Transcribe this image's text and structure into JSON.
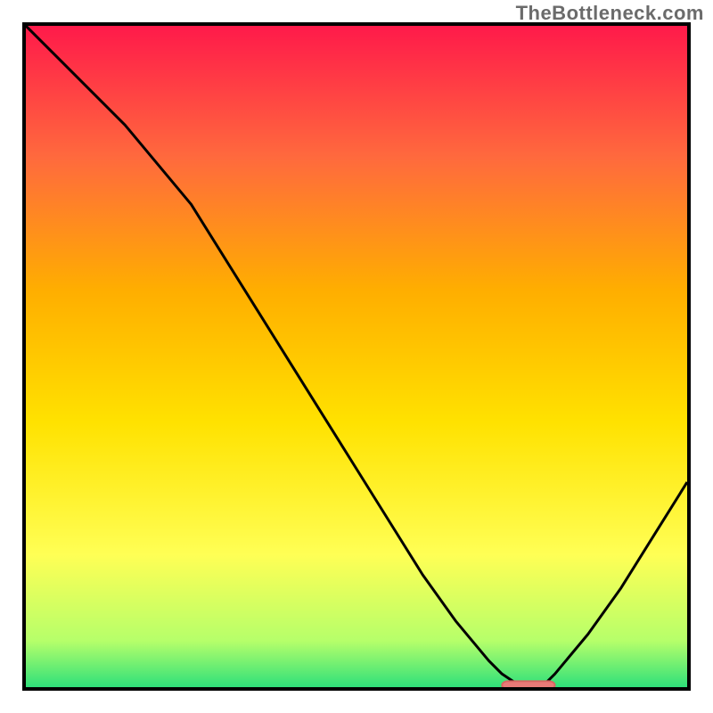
{
  "watermark": "TheBottleneck.com",
  "colors": {
    "border": "#000000",
    "curve": "#000000",
    "marker_fill": "#e97a77",
    "marker_stroke": "#d96461",
    "grad_top": "#ff1a4a",
    "grad_mid1": "#ff6a3d",
    "grad_mid2": "#ffae00",
    "grad_mid3": "#ffe200",
    "grad_yellow": "#ffff55",
    "grad_green1": "#b6ff6a",
    "grad_green2": "#2fe07a"
  },
  "chart_data": {
    "type": "line",
    "title": "",
    "xlabel": "",
    "ylabel": "",
    "xlim": [
      0,
      100
    ],
    "ylim": [
      0,
      100
    ],
    "x": [
      0,
      5,
      10,
      15,
      20,
      25,
      30,
      35,
      40,
      45,
      50,
      55,
      60,
      65,
      70,
      72,
      75,
      78,
      80,
      85,
      90,
      95,
      100
    ],
    "values": [
      100,
      95,
      90,
      85,
      79,
      73,
      65,
      57,
      49,
      41,
      33,
      25,
      17,
      10,
      4,
      2,
      0,
      0,
      2,
      8,
      15,
      23,
      31
    ],
    "marker": {
      "x_range": [
        72,
        80
      ],
      "y": 0
    },
    "gradient_bands": [
      {
        "pos": 0.0,
        "key": "grad_top"
      },
      {
        "pos": 0.2,
        "key": "grad_mid1"
      },
      {
        "pos": 0.4,
        "key": "grad_mid2"
      },
      {
        "pos": 0.6,
        "key": "grad_mid3"
      },
      {
        "pos": 0.8,
        "key": "grad_yellow"
      },
      {
        "pos": 0.93,
        "key": "grad_green1"
      },
      {
        "pos": 1.0,
        "key": "grad_green2"
      }
    ]
  }
}
